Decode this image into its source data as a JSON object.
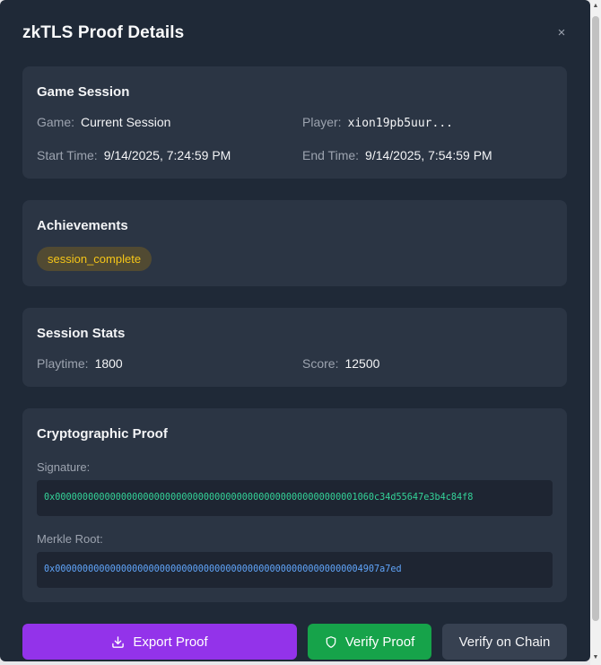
{
  "modal": {
    "title": "zkTLS Proof Details",
    "close_label": "×"
  },
  "game_session": {
    "title": "Game Session",
    "game_label": "Game:",
    "game_value": "Current Session",
    "player_label": "Player:",
    "player_value": "xion19pb5uur...",
    "start_label": "Start Time:",
    "start_value": "9/14/2025, 7:24:59 PM",
    "end_label": "End Time:",
    "end_value": "9/14/2025, 7:54:59 PM"
  },
  "achievements": {
    "title": "Achievements",
    "items": [
      "session_complete"
    ]
  },
  "session_stats": {
    "title": "Session Stats",
    "playtime_label": "Playtime:",
    "playtime_value": "1800",
    "score_label": "Score:",
    "score_value": "12500"
  },
  "crypto_proof": {
    "title": "Cryptographic Proof",
    "signature_label": "Signature:",
    "signature_value": "0x0000000000000000000000000000000000000000000000000000001060c34d55647e3b4c84f8",
    "merkle_label": "Merkle Root:",
    "merkle_value": "0x00000000000000000000000000000000000000000000000000000004907a7ed"
  },
  "actions": {
    "export_label": "Export Proof",
    "verify_label": "Verify Proof",
    "chain_label": "Verify on Chain"
  },
  "colors": {
    "modal_bg": "#1f2937",
    "card_bg": "#2b3544",
    "export_button": "#9333ea",
    "verify_button": "#16a34a",
    "chain_button": "#374151",
    "badge_text": "#f5c518",
    "signature_text": "#34d399",
    "merkle_text": "#60a5fa"
  },
  "icons": {
    "export": "download-icon",
    "verify": "shield-icon"
  }
}
